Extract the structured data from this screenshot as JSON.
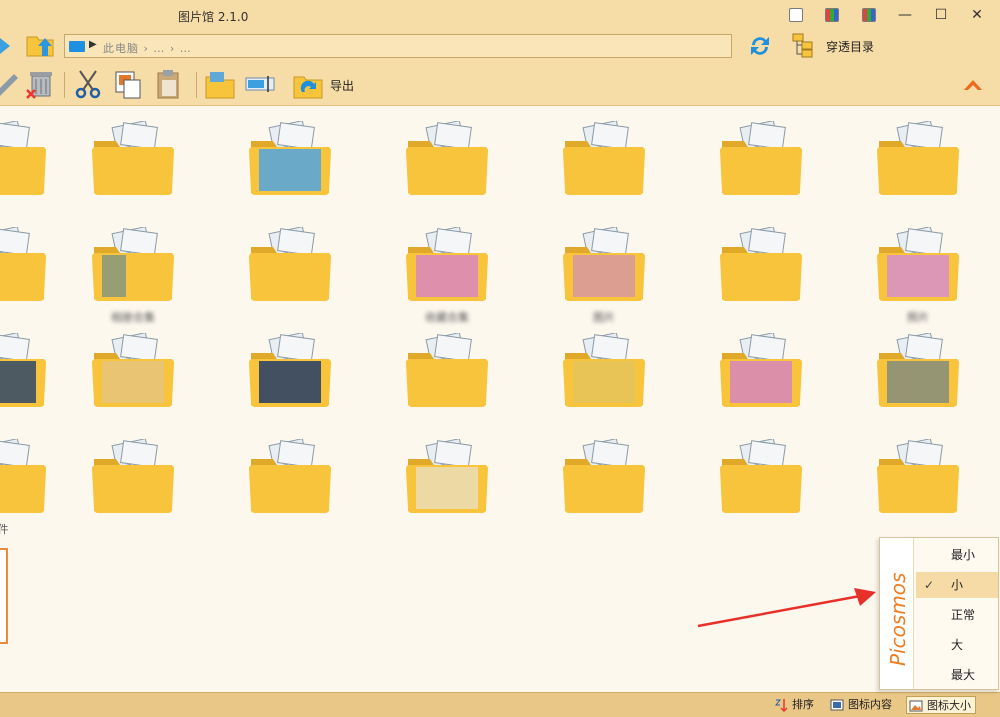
{
  "window": {
    "title": "图片馆 2.1.0",
    "minimize": "—",
    "maximize": "☐",
    "close": "✕"
  },
  "addressbar": {
    "path": "此电脑 › … › …"
  },
  "toolbar": {
    "drill_label": "穿透目录",
    "export_label": "导出"
  },
  "grid": {
    "rows": 4,
    "cols": 6,
    "row2_labels": [
      "相册合集",
      "",
      "收藏合集",
      "图片",
      "",
      "照片"
    ],
    "partial_label": "件"
  },
  "menu": {
    "brand": "Picosmos",
    "items": [
      {
        "label": "最小",
        "checked": false
      },
      {
        "label": "小",
        "checked": true
      },
      {
        "label": "正常",
        "checked": false
      },
      {
        "label": "大",
        "checked": false
      },
      {
        "label": "最大",
        "checked": false
      }
    ],
    "checkmark": "✓"
  },
  "statusbar": {
    "sort_label": "排序",
    "icon_content_label": "图标内容",
    "icon_size_label": "图标大小"
  },
  "colors": {
    "chrome": "#f6dca6",
    "folder": "#f7c43b",
    "accent_orange": "#ef7d22",
    "annotation_arrow": "#e8302a"
  }
}
